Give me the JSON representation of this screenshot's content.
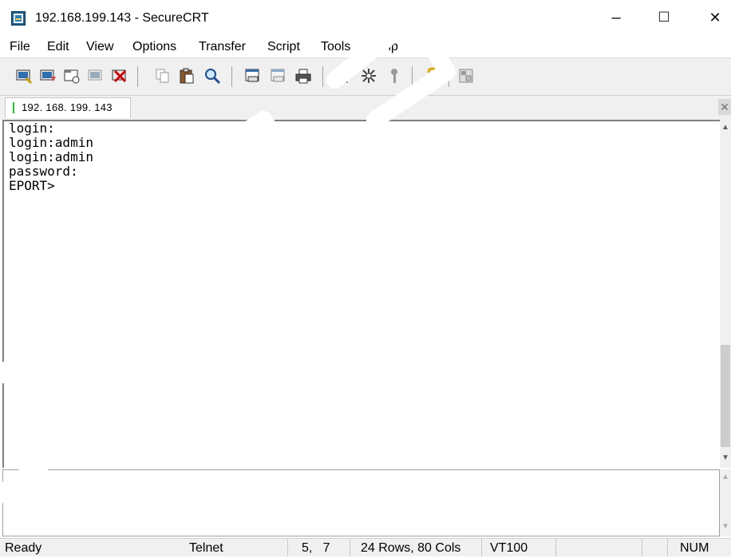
{
  "window": {
    "title": "192.168.199.143 - SecureCRT",
    "minimize_symbol": "–",
    "maximize_symbol": "☐",
    "close_symbol": "✕"
  },
  "menu": [
    "File",
    "Edit",
    "View",
    "Options",
    "Transfer",
    "Script",
    "Tools",
    "Help"
  ],
  "toolbar_icons": [
    "connect-icon",
    "quick-connect-icon",
    "connect-in-tab-icon",
    "reconnect-icon",
    "disconnect-icon",
    "copy-icon",
    "paste-icon",
    "find-icon",
    "print-setup-icon",
    "print-selection-icon",
    "print-icon",
    "session-options-icon",
    "global-options-icon",
    "keymap-icon",
    "help-icon",
    "sftp-icon"
  ],
  "tab": {
    "label": "192. 168. 199. 143",
    "status_color": "#22c02a",
    "close_symbol": "✕"
  },
  "terminal": {
    "lines": [
      "login:",
      "login:admin",
      "login:admin",
      "password:",
      "EPORT>"
    ]
  },
  "statusbar": {
    "ready": "Ready",
    "protocol": "Telnet",
    "cursor": "5,   7",
    "size": "24 Rows,  80 Cols",
    "emulation": "VT100",
    "num": "NUM"
  },
  "watermark": "DEMO"
}
